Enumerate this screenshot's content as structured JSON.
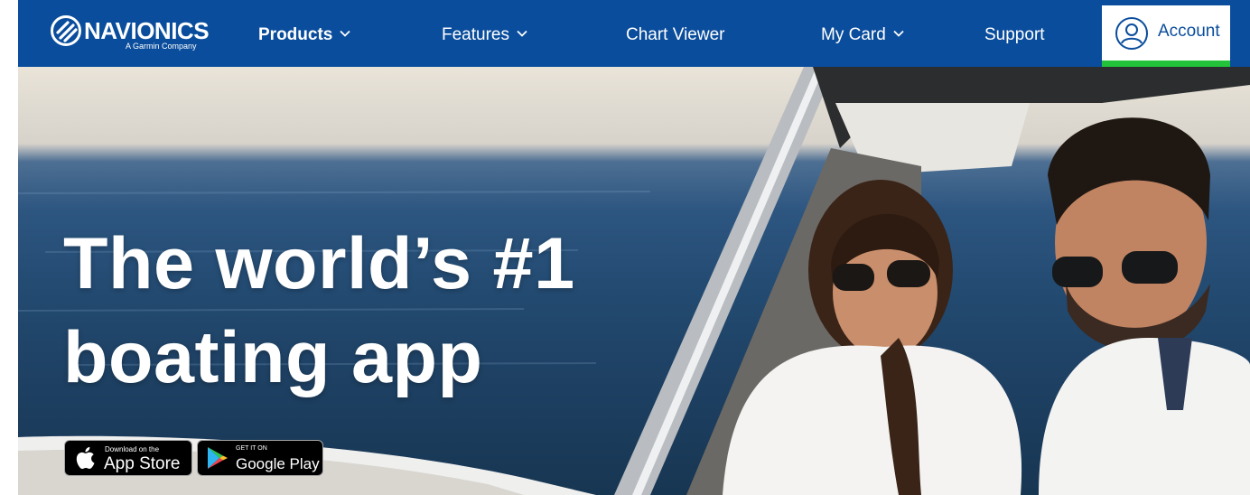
{
  "header": {
    "logo": {
      "brand": "NAVIONICS",
      "tagline": "A Garmin Company"
    },
    "nav": [
      {
        "label": "Products",
        "dropdown": true,
        "active": true
      },
      {
        "label": "Features",
        "dropdown": true
      },
      {
        "label": "Chart Viewer",
        "dropdown": false
      },
      {
        "label": "My Card",
        "dropdown": true
      },
      {
        "label": "Support",
        "dropdown": false
      }
    ],
    "account": {
      "label": "Account",
      "icon": "user-circle-icon"
    }
  },
  "hero": {
    "title_line1": "The world’s #1",
    "title_line2": "boating app",
    "image": "couple-on-boat-photo",
    "stores": {
      "appstore": {
        "small": "Download on the",
        "big": "App Store",
        "icon": "apple-icon"
      },
      "googleplay": {
        "small": "GET IT ON",
        "big": "Google Play",
        "icon": "google-play-icon"
      }
    }
  },
  "colors": {
    "nav_bg": "#0a4d9c",
    "account_accent": "#22c33a",
    "text_on_dark": "#ffffff"
  }
}
